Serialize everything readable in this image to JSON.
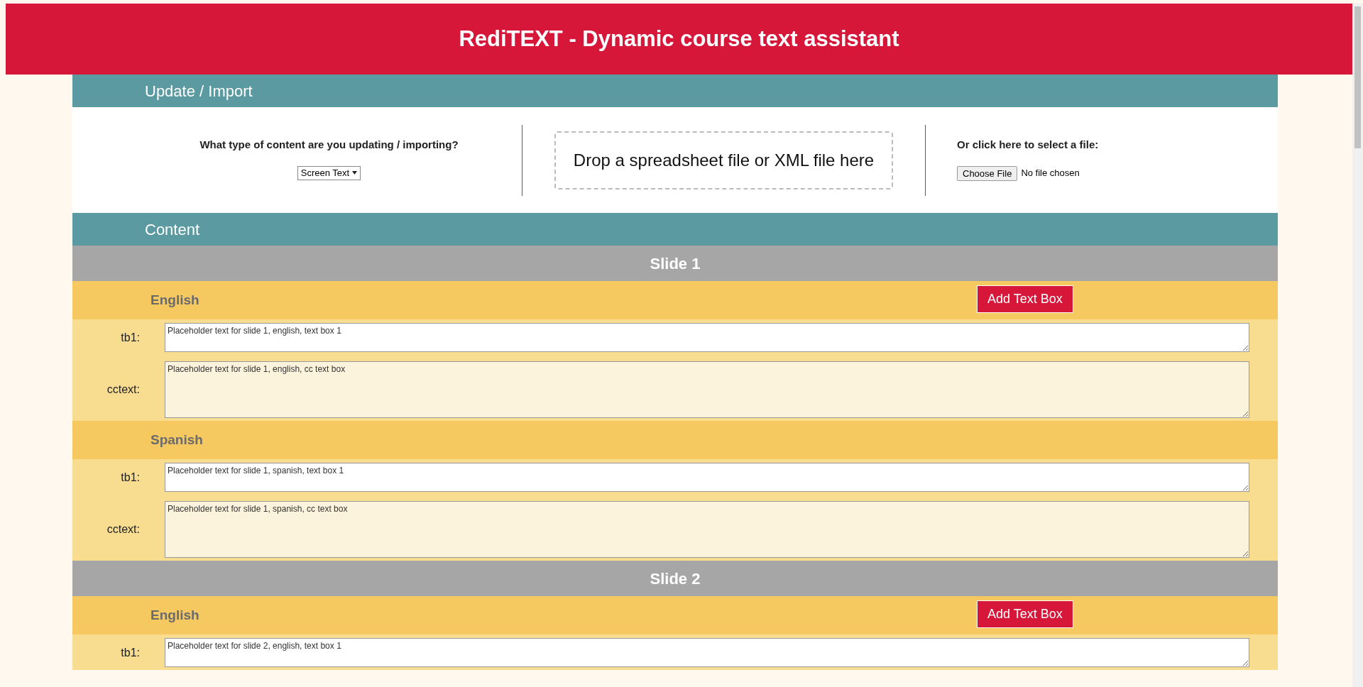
{
  "header": {
    "title": "RediTEXT - Dynamic course text assistant"
  },
  "import_section": {
    "title": "Update / Import",
    "question": "What type of content are you updating / importing?",
    "content_type": {
      "value": "Screen Text"
    },
    "drop_zone": "Drop a spreadsheet file or XML file here",
    "file_prompt": "Or click here to select a file:",
    "file_button": "Choose File",
    "file_status": "No file chosen"
  },
  "content_section": {
    "title": "Content",
    "slides": [
      {
        "title": "Slide 1",
        "languages": [
          {
            "name": "English",
            "add_button": "Add Text Box",
            "fields": [
              {
                "kind": "single",
                "label": "tb1:",
                "value": "Placeholder text for slide 1, english, text box 1"
              },
              {
                "kind": "cc",
                "label": "cctext:",
                "value": "Placeholder text for slide 1, english, cc text box"
              }
            ]
          },
          {
            "name": "Spanish",
            "fields": [
              {
                "kind": "single",
                "label": "tb1:",
                "value": "Placeholder text for slide 1, spanish, text box 1"
              },
              {
                "kind": "cc",
                "label": "cctext:",
                "value": "Placeholder text for slide 1, spanish, cc text box"
              }
            ]
          }
        ]
      },
      {
        "title": "Slide 2",
        "languages": [
          {
            "name": "English",
            "add_button": "Add Text Box",
            "fields": [
              {
                "kind": "single",
                "label": "tb1:",
                "value": "Placeholder text for slide 2, english, text box 1"
              }
            ]
          }
        ]
      }
    ]
  }
}
